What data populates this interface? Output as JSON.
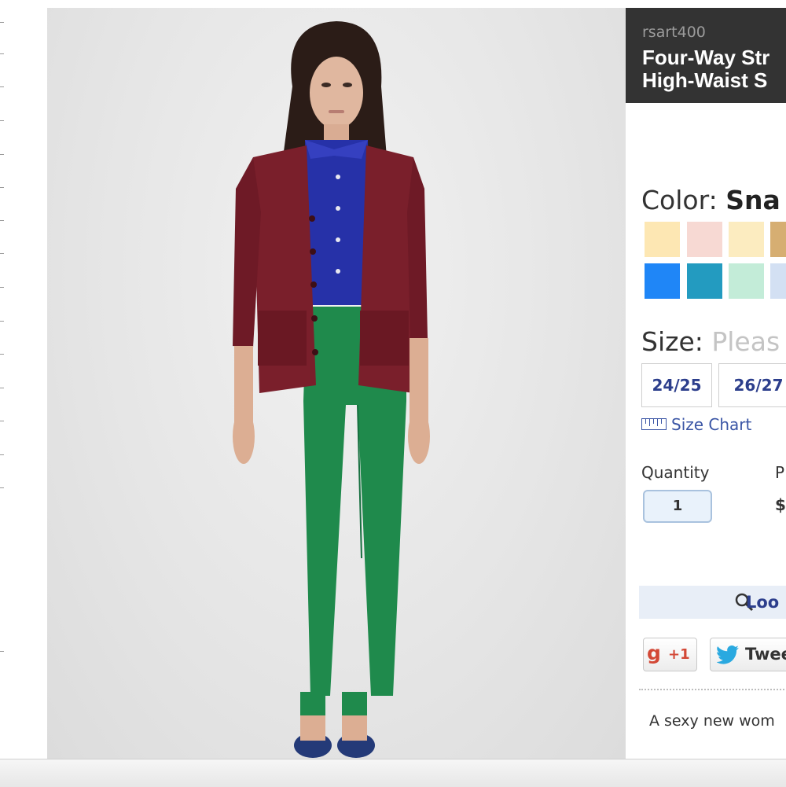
{
  "header": {
    "sku": "rsart400",
    "title": "Four-Way Str\nHigh-Waist S"
  },
  "color": {
    "label": "Color:",
    "selected": "Sna",
    "swatches": [
      {
        "name": "swatch-1",
        "hex": "#fde7b3"
      },
      {
        "name": "swatch-2",
        "hex": "#f7d9d3"
      },
      {
        "name": "swatch-3",
        "hex": "#fcecc0"
      },
      {
        "name": "swatch-4",
        "hex": "#d6ae72"
      },
      {
        "name": "swatch-5",
        "hex": "#1f86f7"
      },
      {
        "name": "swatch-6",
        "hex": "#239bc0"
      },
      {
        "name": "swatch-7",
        "hex": "#c3ecd8"
      },
      {
        "name": "swatch-8",
        "hex": "#d3e0f3"
      }
    ]
  },
  "size": {
    "label": "Size:",
    "placeholder": "Pleas",
    "options": [
      "24/25",
      "26/27"
    ],
    "chart_link": "Size Chart"
  },
  "quantity": {
    "label": "Quantity",
    "value": "1"
  },
  "price": {
    "label": "P",
    "value": "$"
  },
  "lookup": {
    "label": "Loo"
  },
  "social": {
    "gplus_g": "g",
    "gplus_label": "+1",
    "tweet_label": "Twee"
  },
  "description": "A sexy new wom",
  "colors": {
    "header_bg": "#333333",
    "link_blue": "#2c3e8c",
    "cardigan": "#7a1f2b",
    "shirt": "#2631a8",
    "pants": "#1f8a4c"
  }
}
